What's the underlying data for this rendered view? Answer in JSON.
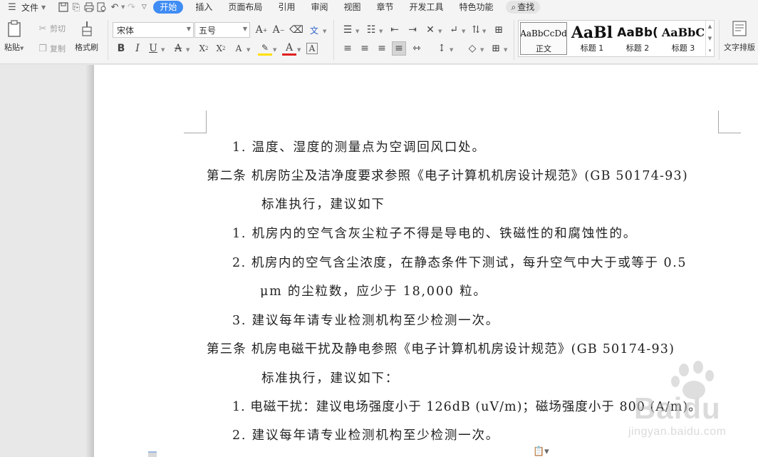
{
  "menubar": {
    "file_label": "文件",
    "tabs": [
      {
        "label": "开始",
        "active": true
      },
      {
        "label": "插入"
      },
      {
        "label": "页面布局"
      },
      {
        "label": "引用"
      },
      {
        "label": "审阅"
      },
      {
        "label": "视图"
      },
      {
        "label": "章节"
      },
      {
        "label": "开发工具"
      },
      {
        "label": "特色功能"
      }
    ],
    "search_label": "查找",
    "accent_color": "#3f8cf4"
  },
  "ribbon": {
    "clipboard": {
      "paste_label": "粘贴",
      "cut_label": "剪切",
      "copy_label": "复制",
      "format_painter_label": "格式刷"
    },
    "font": {
      "font_name": "宋体",
      "font_size": "五号"
    },
    "styles": [
      {
        "sample": "AaBbCcDd",
        "label": "正文",
        "selected": true
      },
      {
        "sample": "AaBl",
        "label": "标题 1"
      },
      {
        "sample": "AaBb(",
        "label": "标题 2"
      },
      {
        "sample": "AaBbC",
        "label": "标题 3"
      }
    ],
    "text_layout_label": "文字排版"
  },
  "document": {
    "lines": [
      {
        "text": "1.  温度、湿度的测量点为空调回风口处。"
      },
      {
        "text": "第二条  机房防尘及洁净度要求参照《电子计算机机房设计规范》(GB 50174-93)"
      },
      {
        "text": "标准执行，建议如下"
      },
      {
        "text": "1.  机房内的空气含灰尘粒子不得是导电的、铁磁性的和腐蚀性的。"
      },
      {
        "text": "2.  机房内的空气含尘浓度，在静态条件下测试，每升空气中大于或等于 0.5"
      },
      {
        "text": "μm 的尘粒数，应少于 18,000 粒。"
      },
      {
        "text": "3.  建议每年请专业检测机构至少检测一次。"
      },
      {
        "text": "第三条  机房电磁干扰及静电参照《电子计算机机房设计规范》(GB 50174-93)"
      },
      {
        "text": "标准执行，建议如下："
      },
      {
        "text": "1.  电磁干扰：建议电场强度小于 126dB (uV/m)；磁场强度小于 800 (A/m)。"
      },
      {
        "text": "2.  建议每年请专业检测机构至少检测一次。"
      }
    ]
  },
  "watermark": {
    "text": "Baidu",
    "sub": "jingyan.baidu.com"
  }
}
